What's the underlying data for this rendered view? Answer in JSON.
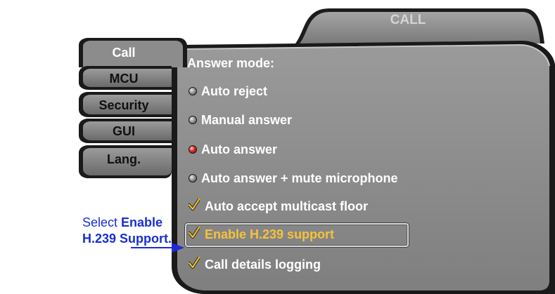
{
  "window": {
    "title": "CALL"
  },
  "tabs": [
    {
      "label": "Call",
      "active": true
    },
    {
      "label": "MCU",
      "active": false
    },
    {
      "label": "Security",
      "active": false
    },
    {
      "label": "GUI",
      "active": false
    },
    {
      "label": "Lang.",
      "active": false
    }
  ],
  "panel": {
    "heading": "Answer mode:",
    "answer_modes": [
      {
        "label": "Auto reject",
        "selected": false
      },
      {
        "label": "Manual answer",
        "selected": false
      },
      {
        "label": "Auto answer",
        "selected": true
      },
      {
        "label": "Auto answer + mute microphone",
        "selected": false
      }
    ],
    "checkboxes": [
      {
        "label": "Auto accept multicast floor",
        "checked": true,
        "focused": false
      },
      {
        "label": "Enable H.239 support",
        "checked": true,
        "focused": true
      },
      {
        "label": "Call details logging",
        "checked": true,
        "focused": false
      }
    ]
  },
  "callout": {
    "prefix": "Select ",
    "bold1": "Enable",
    "bold2": "H.239 Support."
  },
  "colors": {
    "panel": "#8a8a8a",
    "panel_dark": "#2a2a2a",
    "focus_text": "#f6c23a",
    "callout_text": "#1a2fd0",
    "radio_selected": "#e0302e",
    "check": "#f0c22a"
  }
}
